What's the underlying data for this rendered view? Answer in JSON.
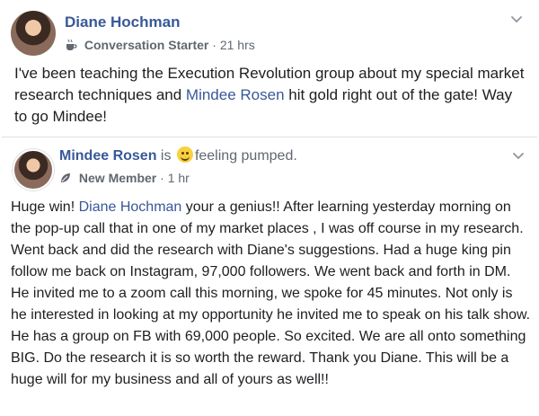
{
  "post": {
    "author": "Diane Hochman",
    "badge": "Conversation Starter",
    "separator": "·",
    "time": "21 hrs",
    "text_before": "I've been teaching the Execution Revolution group about my special market research techniques and ",
    "mention": "Mindee Rosen",
    "text_after": " hit gold right out of the gate! Way to go Mindee!"
  },
  "shared": {
    "author": "Mindee Rosen",
    "is_text": "is",
    "feeling_icon": "smiley-emoji-icon",
    "feeling": "feeling pumped.",
    "badge": "New Member",
    "separator": "·",
    "time": "1 hr",
    "text_before": "Huge win! ",
    "mention": "Diane Hochman",
    "text_after": " your a genius!! After learning yesterday morning on the pop-up call that in one of my market places , I was off course in my research. Went back and did the research with Diane's suggestions. Had a huge king pin follow me back on Instagram, 97,000 followers. We went back and forth in DM. He invited me to a zoom call this morning, we spoke for 45 minutes. Not only is he interested in looking at my opportunity he invited me to speak on his talk show. He has a group on FB with 69,000 people. So excited. We are all onto something BIG. Do the research it is so worth the reward. Thank you Diane. This will be a huge will for my business and all of yours as well!!"
  },
  "colors": {
    "link": "#385898",
    "meta": "#606770",
    "text": "#1c1e21"
  }
}
